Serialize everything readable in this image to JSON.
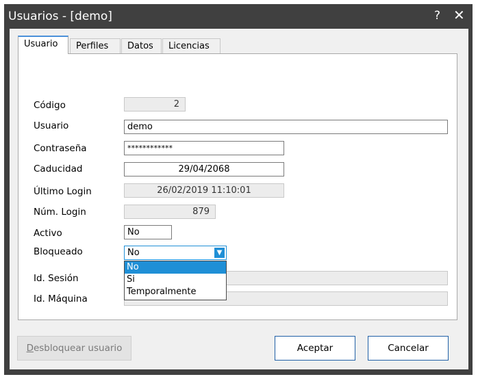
{
  "window": {
    "title": "Usuarios - [demo]",
    "help_glyph": "?",
    "close_glyph": "✕"
  },
  "tabs": [
    {
      "label": "Usuario",
      "active": true
    },
    {
      "label": "Perfiles",
      "active": false
    },
    {
      "label": "Datos",
      "active": false
    },
    {
      "label": "Licencias",
      "active": false
    }
  ],
  "form": {
    "codigo": {
      "label": "Código",
      "value": "2"
    },
    "usuario": {
      "label": "Usuario",
      "value": "demo"
    },
    "contrasena": {
      "label": "Contraseña",
      "value": "************"
    },
    "caducidad": {
      "label": "Caducidad",
      "value": "29/04/2068"
    },
    "ultimo_login": {
      "label": "Último Login",
      "value": "26/02/2019 11:10:01"
    },
    "num_login": {
      "label": "Núm. Login",
      "value": "879"
    },
    "activo": {
      "label": "Activo",
      "value": "No"
    },
    "bloqueado": {
      "label": "Bloqueado",
      "value": "No",
      "options": [
        "No",
        "Si",
        "Temporalmente"
      ]
    },
    "id_sesion": {
      "label": "Id. Sesión",
      "value": ""
    },
    "id_maquina": {
      "label": "Id. Máquina",
      "value": ""
    }
  },
  "buttons": {
    "desbloquear_accel": "D",
    "desbloquear_rest": "esbloquear usuario",
    "aceptar": "Aceptar",
    "cancelar": "Cancelar"
  },
  "colors": {
    "titlebar": "#404040",
    "accent": "#1f8fd6",
    "button_border": "#1f5fa6"
  }
}
